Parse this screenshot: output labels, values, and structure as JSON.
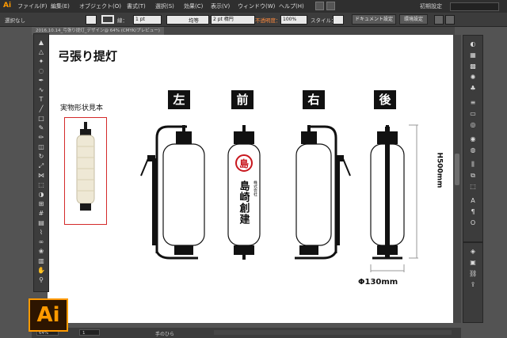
{
  "app": {
    "logo": "Ai"
  },
  "menu": [
    "ファイル(F)",
    "編集(E)",
    "オブジェクト(O)",
    "書式(T)",
    "選択(S)",
    "効果(C)",
    "表示(V)",
    "ウィンドウ(W)",
    "ヘルプ(H)"
  ],
  "workspace": "初期設定",
  "control": {
    "selection_label": "選択なし",
    "stroke_label": "線：",
    "stroke_weight": "1 pt",
    "uniform_label": "均等",
    "brush_label": "2 pt 楕円",
    "opacity_label": "不透明度：",
    "opacity_value": "100%",
    "style_label": "スタイル：",
    "doc_setup_label": "ドキュメント設定",
    "preferences_label": "環境設定"
  },
  "document_tab": "2016.10.14_弓張り提灯_デザイン@ 64% (CMYK/プレビュー)",
  "status": {
    "zoom": "64%",
    "page": "1",
    "tool": "手のひら"
  },
  "artboard": {
    "title": "弓張り提灯",
    "sample_label": "実物形状見本",
    "views": [
      "左",
      "前",
      "右",
      "後"
    ],
    "lantern_text": {
      "crest": "島",
      "company_type": "株式会社",
      "company_name": "島崎創建"
    },
    "height_dim": "H500mm",
    "width_dim": "Φ130mm"
  },
  "colors": {
    "accent": "#ff9a00",
    "crest_red": "#c8171e",
    "sample_border": "#d42a2a"
  }
}
